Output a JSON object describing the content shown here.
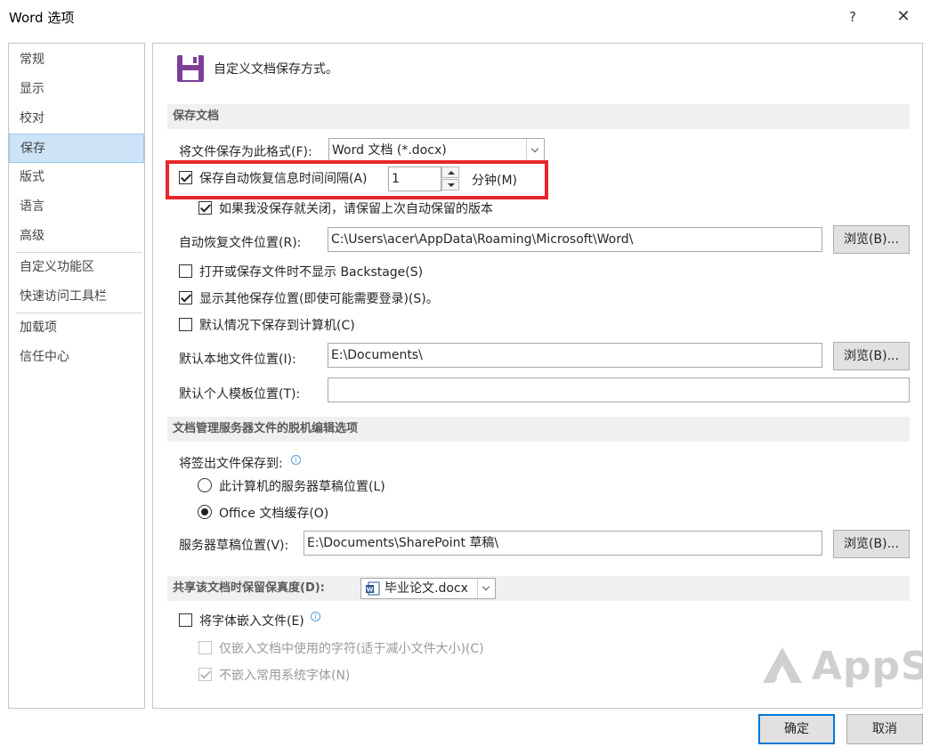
{
  "window": {
    "title": "Word 选项",
    "help": "?",
    "close": "✕"
  },
  "sidebar": {
    "items": [
      {
        "label": "常规"
      },
      {
        "label": "显示"
      },
      {
        "label": "校对"
      },
      {
        "label": "保存"
      },
      {
        "label": "版式"
      },
      {
        "label": "语言"
      },
      {
        "label": "高级"
      },
      {
        "label": "自定义功能区"
      },
      {
        "label": "快速访问工具栏"
      },
      {
        "label": "加载项"
      },
      {
        "label": "信任中心"
      }
    ],
    "active_index": 3
  },
  "header": {
    "title": "自定义文档保存方式。",
    "icon": "save-icon",
    "icon_color": "#7b3f98"
  },
  "save_section": {
    "heading": "保存文档",
    "format_label": "将文件保存为此格式(F):",
    "format_value": "Word 文档 (*.docx)",
    "autorecover_label": "保存自动恢复信息时间间隔(A)",
    "autorecover_checked": true,
    "autorecover_minutes": "1",
    "minutes_label": "分钟(M)",
    "keep_last_label": "如果我没保存就关闭，请保留上次自动保留的版本",
    "keep_last_checked": true,
    "autorecover_location_label": "自动恢复文件位置(R):",
    "autorecover_location_value": "C:\\Users\\acer\\AppData\\Roaming\\Microsoft\\Word\\",
    "browse1": "浏览(B)...",
    "no_backstage_label": "打开或保存文件时不显示 Backstage(S)",
    "no_backstage_checked": false,
    "show_more_label": "显示其他保存位置(即使可能需要登录)(S)。",
    "show_more_checked": true,
    "save_to_computer_label": "默认情况下保存到计算机(C)",
    "save_to_computer_checked": false,
    "default_local_label": "默认本地文件位置(I):",
    "default_local_value": "E:\\Documents\\",
    "browse2": "浏览(B)...",
    "default_template_label": "默认个人模板位置(T):",
    "default_template_value": ""
  },
  "offline_section": {
    "heading": "文档管理服务器文件的脱机编辑选项",
    "checkout_label": "将签出文件保存到:",
    "option_server": "此计算机的服务器草稿位置(L)",
    "option_server_selected": false,
    "option_office": "Office 文档缓存(O)",
    "option_office_selected": true,
    "drafts_label": "服务器草稿位置(V):",
    "drafts_value": "E:\\Documents\\SharePoint 草稿\\",
    "browse3": "浏览(B)..."
  },
  "fidelity_section": {
    "heading": "共享该文档时保留保真度(D):",
    "document": "毕业论文.docx",
    "embed_fonts_label": "将字体嵌入文件(E)",
    "embed_fonts_checked": false,
    "embed_used_label": "仅嵌入文档中使用的字符(适于减小文件大小)(C)",
    "embed_used_checked": false,
    "no_common_label": "不嵌入常用系统字体(N)",
    "no_common_checked": true
  },
  "footer": {
    "ok": "确定",
    "cancel": "取消"
  },
  "watermark": {
    "text": "AppSo"
  },
  "colors": {
    "accent": "#0078d7",
    "highlight": "#e8262b",
    "nav_active": "#cde4f7"
  }
}
